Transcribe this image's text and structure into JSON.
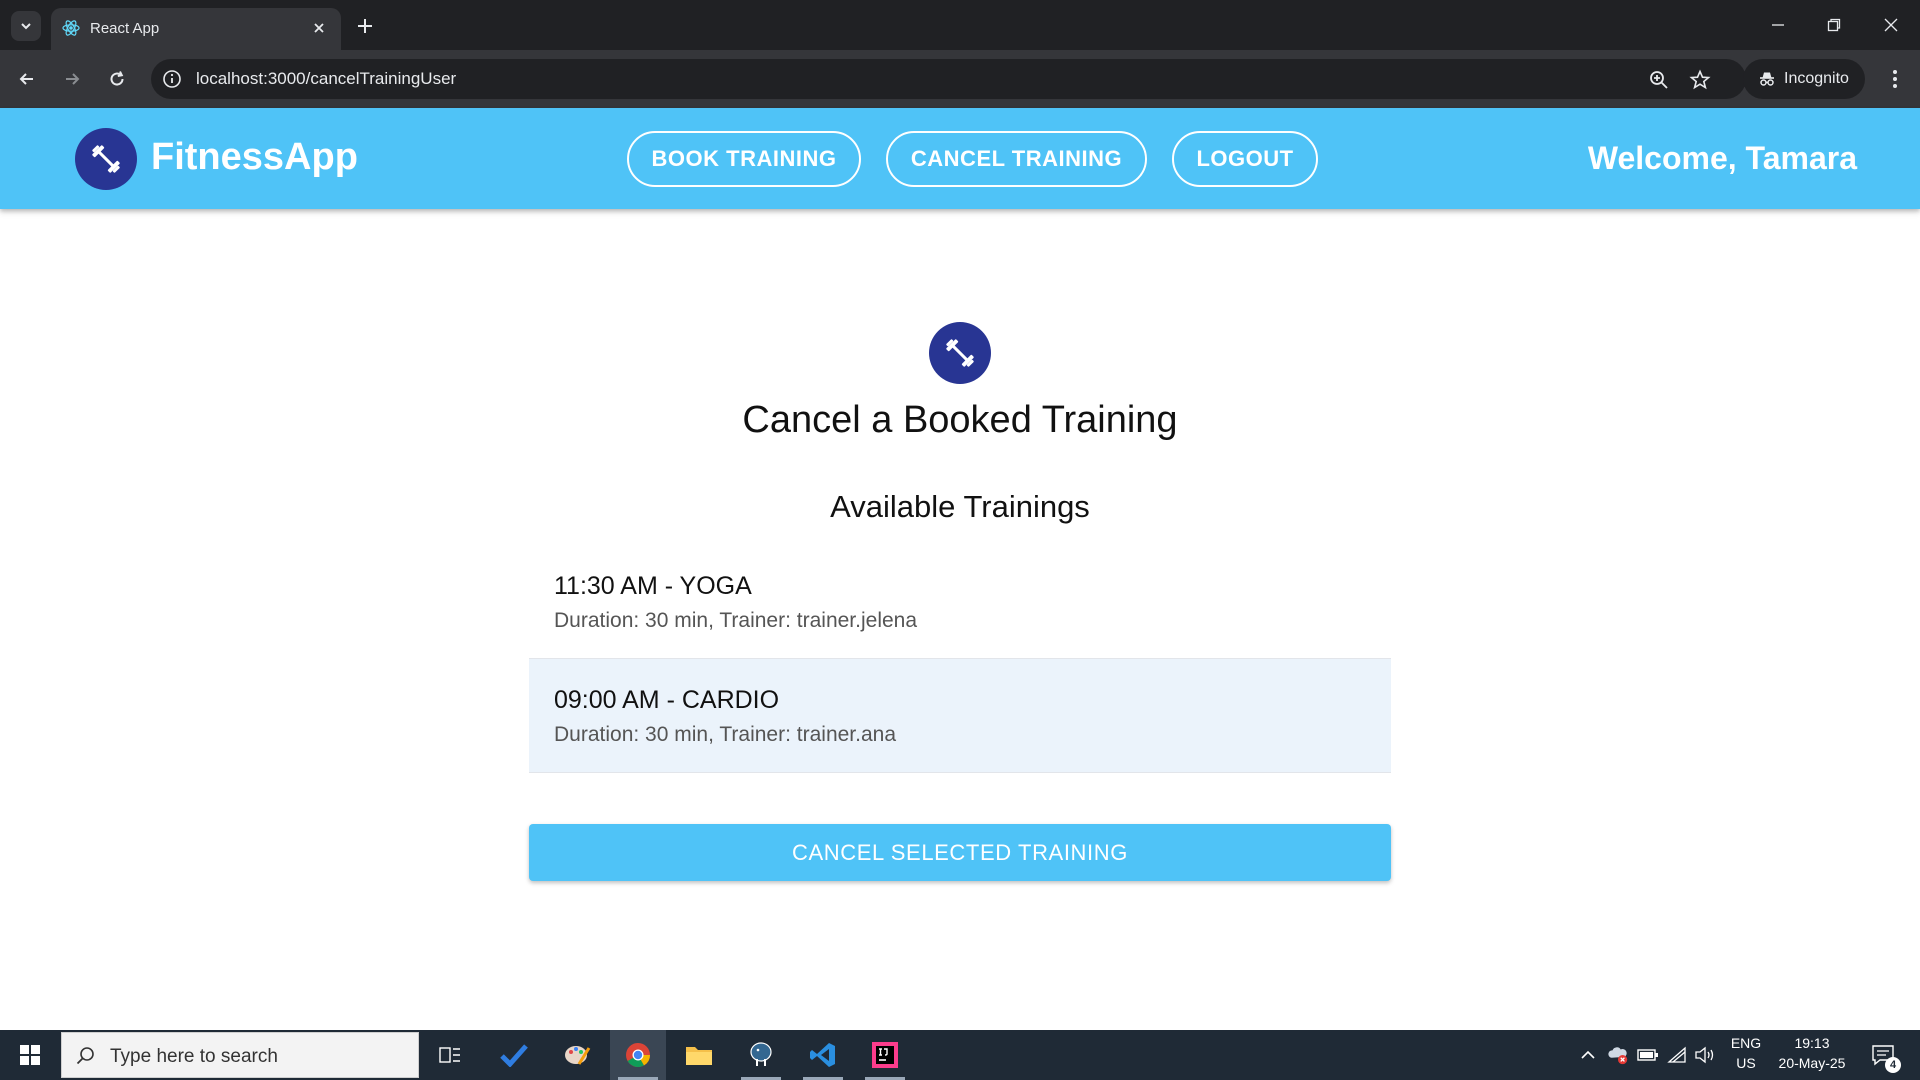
{
  "browser": {
    "tab_title": "React App",
    "url": "localhost:3000/cancelTrainingUser",
    "incognito_label": "Incognito"
  },
  "header": {
    "brand": "FitnessApp",
    "nav": {
      "book": "BOOK TRAINING",
      "cancel": "CANCEL TRAINING",
      "logout": "LOGOUT"
    },
    "welcome": "Welcome, Tamara"
  },
  "main": {
    "title": "Cancel a Booked Training",
    "section_title": "Available Trainings",
    "trainings": [
      {
        "primary": "11:30 AM - YOGA",
        "secondary": "Duration: 30 min, Trainer: trainer.jelena",
        "selected": false
      },
      {
        "primary": "09:00 AM - CARDIO",
        "secondary": "Duration: 30 min, Trainer: trainer.ana",
        "selected": true
      }
    ],
    "cancel_button": "CANCEL SELECTED TRAINING"
  },
  "taskbar": {
    "search_placeholder": "Type here to search",
    "lang_top": "ENG",
    "lang_bottom": "US",
    "time": "19:13",
    "date": "20-May-25",
    "notification_count": "4"
  },
  "colors": {
    "header": "#4fc3f7",
    "logo_bg": "#283593",
    "selected_row": "#ebf3fb",
    "button": "#4fc3f7"
  }
}
